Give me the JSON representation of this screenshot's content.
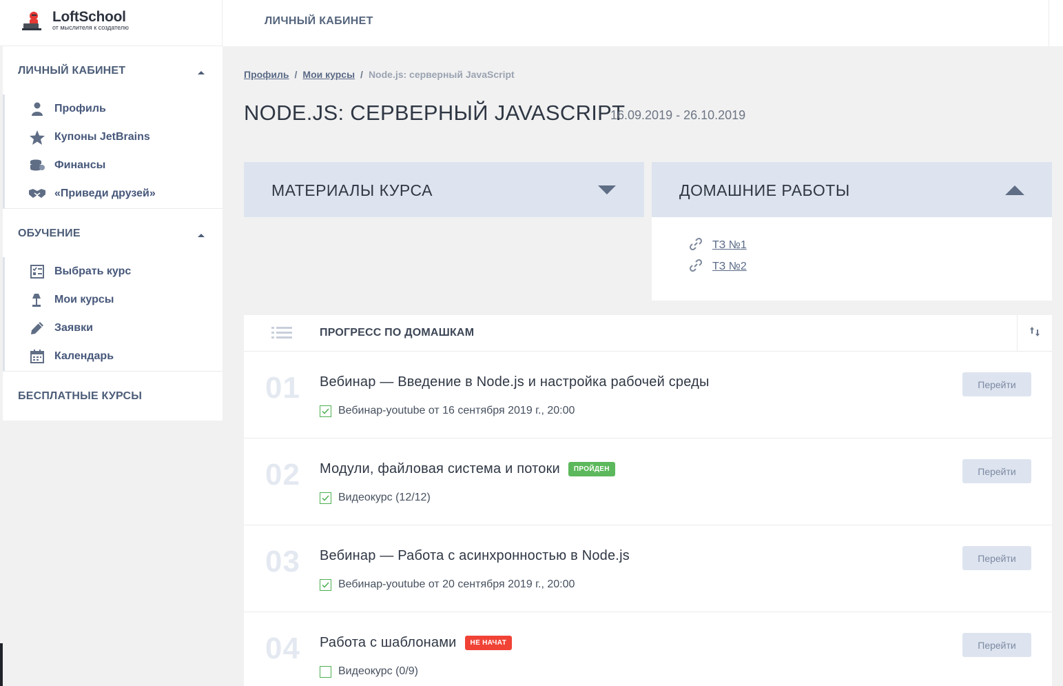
{
  "logo": {
    "name": "LoftSchool",
    "tagline": "от мыслителя к создателю"
  },
  "topbar": {
    "title": "ЛИЧНЫЙ КАБИНЕТ"
  },
  "sidebar": {
    "sections": [
      {
        "label": "ЛИЧНЫЙ КАБИНЕТ"
      },
      {
        "label": "ОБУЧЕНИЕ"
      },
      {
        "label": "БЕСПЛАТНЫЕ КУРСЫ"
      }
    ],
    "items": [
      {
        "label": "Профиль",
        "icon": "user-icon"
      },
      {
        "label": "Купоны JetBrains",
        "icon": "star-icon"
      },
      {
        "label": "Финансы",
        "icon": "coins-icon"
      },
      {
        "label": "«Приведи друзей»",
        "icon": "handshake-icon"
      },
      {
        "label": "Выбрать курс",
        "icon": "checklist-icon"
      },
      {
        "label": "Мои курсы",
        "icon": "lamp-icon"
      },
      {
        "label": "Заявки",
        "icon": "pencil-icon"
      },
      {
        "label": "Календарь",
        "icon": "calendar-icon"
      }
    ]
  },
  "breadcrumb": {
    "profile": "Профиль",
    "my_courses": "Мои курсы",
    "current": "Node.js: серверный JavaScript",
    "sep": "/"
  },
  "course": {
    "title": "NODE.JS: СЕРВЕРНЫЙ JAVASCRIPT",
    "dates": "16.09.2019 - 26.10.2019"
  },
  "materials": {
    "title": "МАТЕРИАЛЫ КУРСА"
  },
  "homework": {
    "title": "ДОМАШНИЕ РАБОТЫ",
    "links": [
      {
        "label": "ТЗ №1"
      },
      {
        "label": "ТЗ №2"
      }
    ]
  },
  "progress": {
    "title": "ПРОГРЕСС ПО ДОМАШКАМ",
    "lessons": [
      {
        "num": "01",
        "title": "Вебинар — Введение в Node.js и настройка рабочей среды",
        "badge": "",
        "sub": "Вебинар-youtube от 16 сентября 2019 г., 20:00",
        "checked": true,
        "button": "Перейти"
      },
      {
        "num": "02",
        "title": "Модули, файловая система и потоки",
        "badge": "ПРОЙДЕН",
        "sub": "Видеокурс (12/12)",
        "checked": true,
        "button": "Перейти"
      },
      {
        "num": "03",
        "title": "Вебинар — Работа с асинхронностью в Node.js",
        "badge": "",
        "sub": "Вебинар-youtube от 20 сентября 2019 г., 20:00",
        "checked": true,
        "button": "Перейти"
      },
      {
        "num": "04",
        "title": "Работа с шаблонами",
        "badge": "НЕ НАЧАТ",
        "sub": "Видеокурс (0/9)",
        "checked": false,
        "button": "Перейти"
      }
    ]
  },
  "colors": {
    "accent_panel": "#dde4ef",
    "badge_done": "#5cb85c",
    "badge_new": "#f04336",
    "check": "#4caf50"
  }
}
